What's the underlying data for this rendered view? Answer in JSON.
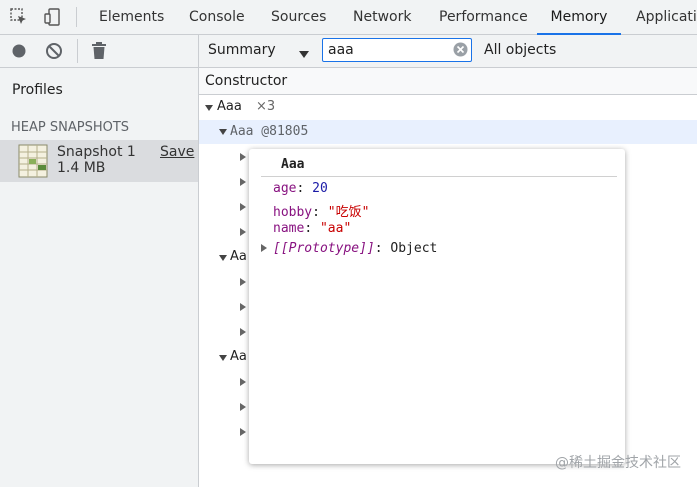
{
  "tabs": {
    "items": [
      "Elements",
      "Console",
      "Sources",
      "Network",
      "Performance",
      "Memory",
      "Applicatio"
    ],
    "active": "Memory"
  },
  "toolbar": {
    "summary_label": "Summary",
    "search_value": "aaa",
    "filter_label": "All objects"
  },
  "sidebar": {
    "profiles_label": "Profiles",
    "section_label": "HEAP SNAPSHOTS",
    "snapshot": {
      "name": "Snapshot 1",
      "size": "1.4 MB",
      "save_label": "Save"
    }
  },
  "grid": {
    "header": "Constructor",
    "group_name": "Aaa",
    "group_count": "×3",
    "selected_row": "Aaa @81805",
    "collapsed_labels": [
      "Aa",
      "Aa"
    ]
  },
  "popover": {
    "title": "Aaa",
    "props": [
      {
        "key": "age",
        "sep": ": ",
        "value": "20"
      },
      {
        "key": "hobby",
        "sep": ": ",
        "value": "\"吃饭\""
      },
      {
        "key": "name",
        "sep": ": ",
        "value": "\"aa\""
      }
    ],
    "proto": {
      "key": "[[Prototype]]",
      "sep": ": ",
      "value": "Object"
    }
  },
  "watermark": "@稀土掘金技术社区",
  "colors": {
    "accent": "#1a73e8",
    "prop_key": "#881280",
    "string_value": "#c80000",
    "number_value": "#1a1aa6"
  }
}
